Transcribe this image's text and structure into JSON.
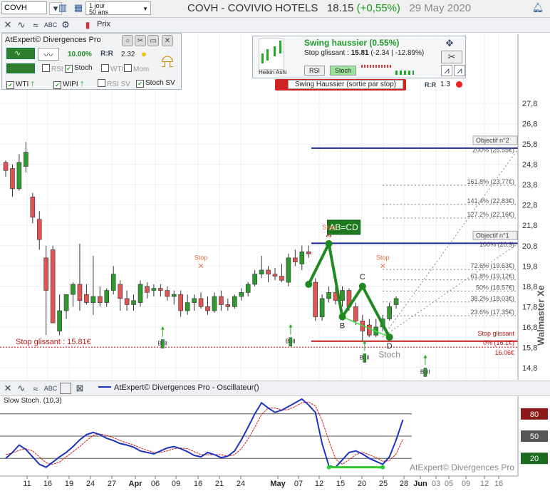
{
  "header": {
    "symbol_value": "COVH",
    "timeframe": "1 jour",
    "period": "50 ans",
    "price_type_label": "Prix",
    "title_name": "COVH - COVIVIO HOTELS",
    "title_price": "18.15",
    "title_change": "(+0,55%)",
    "title_date": "29 May 2020"
  },
  "atexpert_panel": {
    "title": "AtExpert© Divergences Pro",
    "pct": "10.00%",
    "ratio": "2.32",
    "rsi": "RSI",
    "stoch": "Stoch",
    "wti": "WTI",
    "mom": "Mom",
    "wti_up": "WTI",
    "wipi_up": "WIPI",
    "rsi_sv": "RSI SV",
    "stoch_sv": "Stoch SV"
  },
  "swing_panel": {
    "title": "Swing haussier (0.55%)",
    "stop_label": "Stop glissant : ",
    "stop_value": "15.81",
    "stop_changes": " (-2.34 | -12.89%)",
    "heikin": "Heikin Ashi",
    "rsi_chip": "RSI",
    "stoch_chip": "Stoch",
    "ratio": "1.3",
    "banner": "Swing Haussier (sortie par stop)"
  },
  "oscillator_panel": {
    "title": "AtExpert© Divergences Pro - Oscillateur()",
    "indicator": "Slow Stoch. (10,3)",
    "watermark": "AtExpert© Divergences Pro",
    "levels": [
      80,
      50,
      20
    ]
  },
  "side_label": "Walmaster Xe",
  "colors": {
    "up": "#2e9a2e",
    "down": "#e05454",
    "pattern": "#1f8a1f",
    "blue_line": "#1c2a9c",
    "red_line": "#c01818",
    "stoch_k": "#1c34c0",
    "stoch_d": "#d02020"
  },
  "chart_data": {
    "type": "candlestick",
    "price_axis": {
      "ticks": [
        14.8,
        15.8,
        16.8,
        17.8,
        18.8,
        19.8,
        20.8,
        21.8,
        22.8,
        23.8,
        24.8,
        25.8,
        26.8,
        27.8
      ],
      "ylim": [
        14.2,
        28.4
      ]
    },
    "x_ticks": [
      "11",
      "16",
      "19",
      "24",
      "27",
      "Apr",
      "06",
      "09",
      "16",
      "21",
      "24",
      "May",
      "07",
      "12",
      "15",
      "20",
      "25",
      "28",
      "Jun",
      "03",
      "05",
      "09",
      "12",
      "16"
    ],
    "candles": [
      {
        "o": 24.9,
        "h": 25.0,
        "l": 24.2,
        "c": 24.5
      },
      {
        "o": 24.6,
        "h": 24.8,
        "l": 23.2,
        "c": 23.6
      },
      {
        "o": 23.6,
        "h": 25.3,
        "l": 23.5,
        "c": 24.9
      },
      {
        "o": 24.7,
        "h": 25.9,
        "l": 24.4,
        "c": 25.4
      },
      {
        "o": 23.2,
        "h": 23.4,
        "l": 21.9,
        "c": 22.2
      },
      {
        "o": 22.1,
        "h": 22.5,
        "l": 20.6,
        "c": 21.1
      },
      {
        "o": 20.2,
        "h": 20.8,
        "l": 16.4,
        "c": 18.6
      },
      {
        "o": 20.6,
        "h": 20.8,
        "l": 17.2,
        "c": 17.0
      },
      {
        "o": 16.6,
        "h": 18.4,
        "l": 16.4,
        "c": 17.6
      },
      {
        "o": 17.6,
        "h": 18.2,
        "l": 17.2,
        "c": 18.4
      },
      {
        "o": 18.4,
        "h": 19.0,
        "l": 17.8,
        "c": 18.9
      },
      {
        "o": 18.9,
        "h": 20.9,
        "l": 17.6,
        "c": 18.1
      },
      {
        "o": 18.4,
        "h": 18.9,
        "l": 17.9,
        "c": 18.0
      },
      {
        "o": 18.0,
        "h": 20.3,
        "l": 17.4,
        "c": 18.3
      },
      {
        "o": 18.3,
        "h": 18.8,
        "l": 17.8,
        "c": 18.0
      },
      {
        "o": 18.0,
        "h": 18.7,
        "l": 17.8,
        "c": 18.6
      },
      {
        "o": 18.6,
        "h": 19.8,
        "l": 18.4,
        "c": 19.4
      },
      {
        "o": 18.9,
        "h": 19.1,
        "l": 17.6,
        "c": 18.2
      },
      {
        "o": 18.2,
        "h": 18.6,
        "l": 17.6,
        "c": 17.9
      },
      {
        "o": 17.9,
        "h": 18.4,
        "l": 17.6,
        "c": 18.1
      },
      {
        "o": 18.0,
        "h": 19.1,
        "l": 17.8,
        "c": 18.9
      },
      {
        "o": 18.8,
        "h": 19.0,
        "l": 18.2,
        "c": 18.5
      },
      {
        "o": 18.6,
        "h": 18.9,
        "l": 18.3,
        "c": 18.7
      },
      {
        "o": 18.7,
        "h": 18.9,
        "l": 18.3,
        "c": 18.6
      },
      {
        "o": 18.6,
        "h": 18.8,
        "l": 18.1,
        "c": 18.3
      },
      {
        "o": 18.3,
        "h": 18.6,
        "l": 17.9,
        "c": 18.4
      },
      {
        "o": 18.4,
        "h": 18.6,
        "l": 17.3,
        "c": 17.6
      },
      {
        "o": 17.6,
        "h": 18.4,
        "l": 17.4,
        "c": 18.0
      },
      {
        "o": 18.0,
        "h": 18.4,
        "l": 17.6,
        "c": 18.2
      },
      {
        "o": 18.2,
        "h": 18.5,
        "l": 17.7,
        "c": 17.8
      },
      {
        "o": 17.8,
        "h": 18.3,
        "l": 17.4,
        "c": 17.6
      },
      {
        "o": 17.6,
        "h": 18.5,
        "l": 17.5,
        "c": 18.3
      },
      {
        "o": 18.3,
        "h": 18.6,
        "l": 17.6,
        "c": 17.9
      },
      {
        "o": 17.9,
        "h": 18.2,
        "l": 17.6,
        "c": 17.8
      },
      {
        "o": 17.8,
        "h": 18.4,
        "l": 17.7,
        "c": 18.3
      },
      {
        "o": 18.3,
        "h": 18.7,
        "l": 18.1,
        "c": 18.5
      },
      {
        "o": 18.5,
        "h": 19.0,
        "l": 18.3,
        "c": 18.9
      },
      {
        "o": 18.9,
        "h": 19.6,
        "l": 18.8,
        "c": 19.4
      },
      {
        "o": 19.4,
        "h": 20.3,
        "l": 19.2,
        "c": 19.6
      },
      {
        "o": 19.6,
        "h": 19.8,
        "l": 19.0,
        "c": 19.4
      },
      {
        "o": 19.4,
        "h": 19.7,
        "l": 19.1,
        "c": 19.3
      },
      {
        "o": 19.3,
        "h": 19.9,
        "l": 19.0,
        "c": 19.1
      },
      {
        "o": 19.0,
        "h": 20.4,
        "l": 18.8,
        "c": 20.2
      },
      {
        "o": 20.2,
        "h": 20.6,
        "l": 19.8,
        "c": 20.0
      },
      {
        "o": 19.9,
        "h": 20.8,
        "l": 19.6,
        "c": 20.5
      },
      {
        "o": 20.5,
        "h": 20.8,
        "l": 20.2,
        "c": 20.4
      },
      {
        "o": 19.0,
        "h": 19.2,
        "l": 17.1,
        "c": 17.3
      },
      {
        "o": 17.3,
        "h": 18.4,
        "l": 17.1,
        "c": 18.2
      },
      {
        "o": 18.2,
        "h": 18.8,
        "l": 18.0,
        "c": 18.5
      },
      {
        "o": 18.5,
        "h": 18.8,
        "l": 17.9,
        "c": 18.1
      },
      {
        "o": 18.1,
        "h": 18.8,
        "l": 17.8,
        "c": 18.6
      },
      {
        "o": 18.6,
        "h": 18.7,
        "l": 17.6,
        "c": 17.8
      },
      {
        "o": 17.8,
        "h": 18.0,
        "l": 16.9,
        "c": 17.1
      },
      {
        "o": 17.1,
        "h": 17.4,
        "l": 16.1,
        "c": 16.6
      },
      {
        "o": 16.9,
        "h": 17.2,
        "l": 16.3,
        "c": 16.4
      },
      {
        "o": 16.4,
        "h": 17.2,
        "l": 16.3,
        "c": 16.8
      },
      {
        "o": 16.8,
        "h": 17.4,
        "l": 16.6,
        "c": 17.2
      },
      {
        "o": 17.2,
        "h": 18.0,
        "l": 17.1,
        "c": 17.8
      },
      {
        "o": 17.9,
        "h": 18.3,
        "l": 17.7,
        "c": 18.2
      }
    ],
    "pattern": {
      "label": "AB=CD",
      "points": [
        {
          "name": "",
          "bar": 45,
          "price": 18.9
        },
        {
          "name": "A",
          "bar": 48,
          "price": 20.9
        },
        {
          "name": "B",
          "bar": 50,
          "price": 17.3
        },
        {
          "name": "C",
          "bar": 53,
          "price": 18.8
        },
        {
          "name": "D",
          "bar": 57,
          "price": 16.3
        }
      ]
    },
    "objectives": [
      {
        "label": "Objectif n°2",
        "price": 25.6,
        "style": "solid"
      },
      {
        "label": "200% (25.55€)",
        "price": 25.55,
        "style": "none"
      },
      {
        "label": "161.8% (23.77€)",
        "price": 23.77,
        "style": "dotted"
      },
      {
        "label": "141.4% (22.83€)",
        "price": 22.83,
        "style": "dotted"
      },
      {
        "label": "127.2% (22.16€)",
        "price": 22.16,
        "style": "dotted"
      },
      {
        "label": "Objectif n°1",
        "price": 20.92,
        "style": "solid"
      },
      {
        "label": "100% (20.9)",
        "price": 20.9,
        "style": "none"
      },
      {
        "label": "72.6% (19.63€)",
        "price": 19.63,
        "style": "dotted"
      },
      {
        "label": "61.8% (19.12€)",
        "price": 19.12,
        "style": "dotted"
      },
      {
        "label": "50% (18.57€)",
        "price": 18.57,
        "style": "dotted"
      },
      {
        "label": "38.2% (18.03€)",
        "price": 18.03,
        "style": "dotted"
      },
      {
        "label": "23.6% (17.35€)",
        "price": 17.35,
        "style": "dotted"
      }
    ],
    "stop_lines": [
      {
        "label": "Stop glissant : 15.81€",
        "price": 15.81,
        "color": "red-dotted"
      },
      {
        "label": "Stop glissant",
        "price": 16.1,
        "color": "red-solid"
      },
      {
        "label": "0% (16.1€)",
        "price": 16.05,
        "color": "none"
      },
      {
        "label": "16.06€",
        "price": 15.85,
        "color": "none"
      }
    ],
    "annotations": [
      {
        "type": "stop",
        "label": "Stop",
        "bar": 29,
        "price": 20.1
      },
      {
        "type": "stop",
        "label": "Stop",
        "bar": 48,
        "price": 21.6
      },
      {
        "type": "stop",
        "label": "Stop",
        "bar": 56,
        "price": 20.1
      },
      {
        "type": "bull",
        "label": "Bull",
        "bar": 23,
        "price": 15.9
      },
      {
        "type": "bull",
        "label": "Bull",
        "bar": 42,
        "price": 16.0
      },
      {
        "type": "bull",
        "label": "Bull",
        "bar": 53,
        "price": 15.2
      },
      {
        "type": "bull",
        "label": "Bull",
        "bar": 62,
        "price": 14.5
      },
      {
        "type": "text",
        "label": "Stoch",
        "bar": 57,
        "price": 15.3
      }
    ],
    "oscillator": {
      "ylim": [
        0,
        100
      ],
      "k": [
        20,
        28,
        38,
        32,
        22,
        12,
        8,
        15,
        22,
        28,
        36,
        45,
        52,
        55,
        52,
        47,
        44,
        40,
        38,
        35,
        30,
        28,
        26,
        30,
        34,
        36,
        33,
        29,
        24,
        22,
        28,
        25,
        21,
        23,
        30,
        45,
        62,
        80,
        95,
        88,
        82,
        85,
        90,
        95,
        100,
        92,
        82,
        40,
        10,
        8,
        18,
        28,
        30,
        26,
        20,
        16,
        12,
        22,
        45,
        72
      ],
      "d": [
        25,
        27,
        31,
        33,
        30,
        22,
        14,
        12,
        15,
        22,
        29,
        36,
        44,
        51,
        53,
        51,
        48,
        44,
        41,
        38,
        34,
        31,
        28,
        28,
        30,
        33,
        34,
        33,
        29,
        25,
        25,
        25,
        25,
        23,
        25,
        33,
        46,
        62,
        79,
        88,
        88,
        85,
        86,
        90,
        95,
        96,
        91,
        71,
        44,
        19,
        12,
        18,
        25,
        28,
        25,
        21,
        16,
        17,
        26,
        46
      ],
      "divergence": {
        "from": 48,
        "to": 56,
        "value": 8
      }
    }
  }
}
